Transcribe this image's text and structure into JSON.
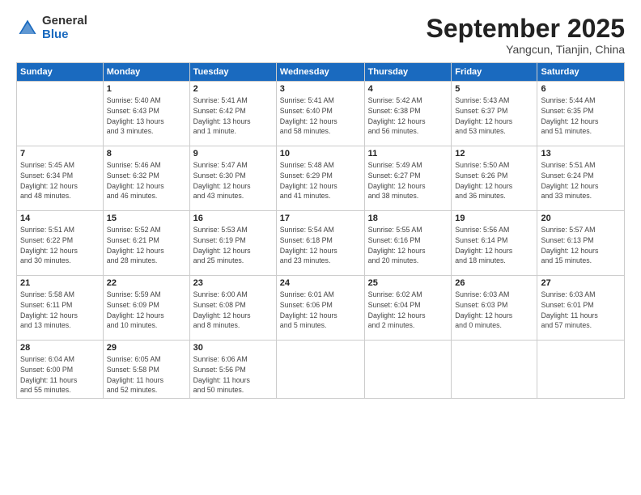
{
  "header": {
    "logo_general": "General",
    "logo_blue": "Blue",
    "month": "September 2025",
    "location": "Yangcun, Tianjin, China"
  },
  "weekdays": [
    "Sunday",
    "Monday",
    "Tuesday",
    "Wednesday",
    "Thursday",
    "Friday",
    "Saturday"
  ],
  "weeks": [
    [
      {
        "day": "",
        "info": ""
      },
      {
        "day": "1",
        "info": "Sunrise: 5:40 AM\nSunset: 6:43 PM\nDaylight: 13 hours\nand 3 minutes."
      },
      {
        "day": "2",
        "info": "Sunrise: 5:41 AM\nSunset: 6:42 PM\nDaylight: 13 hours\nand 1 minute."
      },
      {
        "day": "3",
        "info": "Sunrise: 5:41 AM\nSunset: 6:40 PM\nDaylight: 12 hours\nand 58 minutes."
      },
      {
        "day": "4",
        "info": "Sunrise: 5:42 AM\nSunset: 6:38 PM\nDaylight: 12 hours\nand 56 minutes."
      },
      {
        "day": "5",
        "info": "Sunrise: 5:43 AM\nSunset: 6:37 PM\nDaylight: 12 hours\nand 53 minutes."
      },
      {
        "day": "6",
        "info": "Sunrise: 5:44 AM\nSunset: 6:35 PM\nDaylight: 12 hours\nand 51 minutes."
      }
    ],
    [
      {
        "day": "7",
        "info": "Sunrise: 5:45 AM\nSunset: 6:34 PM\nDaylight: 12 hours\nand 48 minutes."
      },
      {
        "day": "8",
        "info": "Sunrise: 5:46 AM\nSunset: 6:32 PM\nDaylight: 12 hours\nand 46 minutes."
      },
      {
        "day": "9",
        "info": "Sunrise: 5:47 AM\nSunset: 6:30 PM\nDaylight: 12 hours\nand 43 minutes."
      },
      {
        "day": "10",
        "info": "Sunrise: 5:48 AM\nSunset: 6:29 PM\nDaylight: 12 hours\nand 41 minutes."
      },
      {
        "day": "11",
        "info": "Sunrise: 5:49 AM\nSunset: 6:27 PM\nDaylight: 12 hours\nand 38 minutes."
      },
      {
        "day": "12",
        "info": "Sunrise: 5:50 AM\nSunset: 6:26 PM\nDaylight: 12 hours\nand 36 minutes."
      },
      {
        "day": "13",
        "info": "Sunrise: 5:51 AM\nSunset: 6:24 PM\nDaylight: 12 hours\nand 33 minutes."
      }
    ],
    [
      {
        "day": "14",
        "info": "Sunrise: 5:51 AM\nSunset: 6:22 PM\nDaylight: 12 hours\nand 30 minutes."
      },
      {
        "day": "15",
        "info": "Sunrise: 5:52 AM\nSunset: 6:21 PM\nDaylight: 12 hours\nand 28 minutes."
      },
      {
        "day": "16",
        "info": "Sunrise: 5:53 AM\nSunset: 6:19 PM\nDaylight: 12 hours\nand 25 minutes."
      },
      {
        "day": "17",
        "info": "Sunrise: 5:54 AM\nSunset: 6:18 PM\nDaylight: 12 hours\nand 23 minutes."
      },
      {
        "day": "18",
        "info": "Sunrise: 5:55 AM\nSunset: 6:16 PM\nDaylight: 12 hours\nand 20 minutes."
      },
      {
        "day": "19",
        "info": "Sunrise: 5:56 AM\nSunset: 6:14 PM\nDaylight: 12 hours\nand 18 minutes."
      },
      {
        "day": "20",
        "info": "Sunrise: 5:57 AM\nSunset: 6:13 PM\nDaylight: 12 hours\nand 15 minutes."
      }
    ],
    [
      {
        "day": "21",
        "info": "Sunrise: 5:58 AM\nSunset: 6:11 PM\nDaylight: 12 hours\nand 13 minutes."
      },
      {
        "day": "22",
        "info": "Sunrise: 5:59 AM\nSunset: 6:09 PM\nDaylight: 12 hours\nand 10 minutes."
      },
      {
        "day": "23",
        "info": "Sunrise: 6:00 AM\nSunset: 6:08 PM\nDaylight: 12 hours\nand 8 minutes."
      },
      {
        "day": "24",
        "info": "Sunrise: 6:01 AM\nSunset: 6:06 PM\nDaylight: 12 hours\nand 5 minutes."
      },
      {
        "day": "25",
        "info": "Sunrise: 6:02 AM\nSunset: 6:04 PM\nDaylight: 12 hours\nand 2 minutes."
      },
      {
        "day": "26",
        "info": "Sunrise: 6:03 AM\nSunset: 6:03 PM\nDaylight: 12 hours\nand 0 minutes."
      },
      {
        "day": "27",
        "info": "Sunrise: 6:03 AM\nSunset: 6:01 PM\nDaylight: 11 hours\nand 57 minutes."
      }
    ],
    [
      {
        "day": "28",
        "info": "Sunrise: 6:04 AM\nSunset: 6:00 PM\nDaylight: 11 hours\nand 55 minutes."
      },
      {
        "day": "29",
        "info": "Sunrise: 6:05 AM\nSunset: 5:58 PM\nDaylight: 11 hours\nand 52 minutes."
      },
      {
        "day": "30",
        "info": "Sunrise: 6:06 AM\nSunset: 5:56 PM\nDaylight: 11 hours\nand 50 minutes."
      },
      {
        "day": "",
        "info": ""
      },
      {
        "day": "",
        "info": ""
      },
      {
        "day": "",
        "info": ""
      },
      {
        "day": "",
        "info": ""
      }
    ]
  ]
}
